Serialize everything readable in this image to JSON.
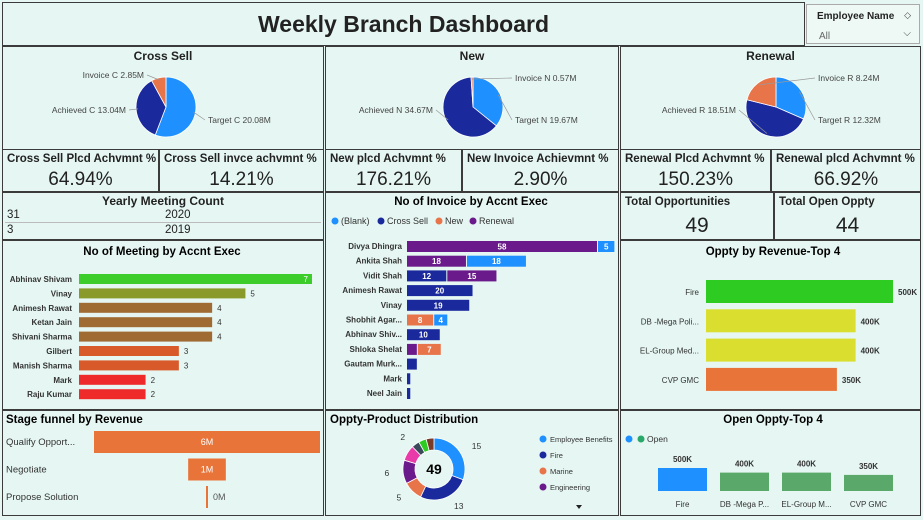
{
  "header": {
    "title": "Weekly Branch Dashboard"
  },
  "slicer": {
    "label": "Employee Name",
    "value": "All"
  },
  "pies": [
    {
      "title": "Cross Sell",
      "slices": [
        {
          "label": "Target C 20.08M",
          "value": 20.08,
          "color": "#1e90ff"
        },
        {
          "label": "Achieved C 13.04M",
          "value": 13.04,
          "color": "#1a2a9c"
        },
        {
          "label": "Invoice C 2.85M",
          "value": 2.85,
          "color": "#e8744a"
        }
      ]
    },
    {
      "title": "New",
      "slices": [
        {
          "label": "Target N 19.67M",
          "value": 19.67,
          "color": "#1e90ff"
        },
        {
          "label": "Achieved N 34.67M",
          "value": 34.67,
          "color": "#1a2a9c"
        },
        {
          "label": "Invoice N 0.57M",
          "value": 0.57,
          "color": "#e8744a"
        }
      ]
    },
    {
      "title": "Renewal",
      "slices": [
        {
          "label": "Target R 12.32M",
          "value": 12.32,
          "color": "#1e90ff"
        },
        {
          "label": "Achieved R 18.51M",
          "value": 18.51,
          "color": "#1a2a9c"
        },
        {
          "label": "Invoice R 8.24M",
          "value": 8.24,
          "color": "#e8744a"
        }
      ]
    }
  ],
  "kpis": [
    {
      "label": "Cross Sell Plcd Achvmnt %",
      "value": "64.94%"
    },
    {
      "label": "Cross Sell invce achvmnt %",
      "value": "14.21%"
    },
    {
      "label": "New plcd Achvmnt %",
      "value": "176.21%"
    },
    {
      "label": "New Invoice Achievmnt %",
      "value": "2.90%"
    },
    {
      "label": "Renewal Plcd Achvmnt %",
      "value": "150.23%"
    },
    {
      "label": "Renewal plcd Achvmnt %",
      "value": "66.92%"
    }
  ],
  "yearly_meeting": {
    "title": "Yearly Meeting Count",
    "rows": [
      {
        "count": "31",
        "year": "2020"
      },
      {
        "count": "3",
        "year": "2019"
      }
    ]
  },
  "opportunities": [
    {
      "label": "Total Opportunities",
      "value": "49"
    },
    {
      "label": "Total Open Oppty",
      "value": "44"
    }
  ],
  "chart_data": [
    {
      "type": "bar",
      "title": "No of Meeting by Accnt Exec",
      "categories": [
        "Abhinav Shivam",
        "Vinay",
        "Animesh Rawat",
        "Ketan Jain",
        "Shivani Sharma",
        "Gilbert",
        "Manish Sharma",
        "Mark",
        "Raju Kumar"
      ],
      "values": [
        7,
        5,
        4,
        4,
        4,
        3,
        3,
        2,
        2
      ],
      "colors": [
        "#3ccd2b",
        "#8a9a2a",
        "#a06a33",
        "#a06a33",
        "#a06a33",
        "#d85a2a",
        "#d85a2a",
        "#ee2a2a",
        "#ee2a2a"
      ]
    },
    {
      "type": "bar",
      "title": "No of Invoice by Accnt Exec",
      "legend": [
        {
          "name": "(Blank)",
          "color": "#1e90ff"
        },
        {
          "name": "Cross Sell",
          "color": "#1a2a9c"
        },
        {
          "name": "New",
          "color": "#e8744a"
        },
        {
          "name": "Renewal",
          "color": "#6a1a8a"
        }
      ],
      "categories": [
        "Divya Dhingra",
        "Ankita Shah",
        "Vidit Shah",
        "Animesh Rawat",
        "Vinay",
        "Shobhit Agar...",
        "Abhinav Shiv...",
        "Shloka Shelat",
        "Gautam Murk...",
        "Mark",
        "Neel Jain"
      ],
      "series": [
        {
          "name": "Renewal",
          "values": [
            58,
            18,
            15,
            null,
            null,
            null,
            null,
            3,
            null,
            null,
            null
          ]
        },
        {
          "name": "(Blank)",
          "values": [
            5,
            18,
            null,
            null,
            null,
            4,
            null,
            null,
            null,
            null,
            null
          ]
        },
        {
          "name": "Cross Sell",
          "values": [
            null,
            null,
            12,
            20,
            19,
            null,
            10,
            null,
            3,
            1,
            1
          ]
        },
        {
          "name": "New",
          "values": [
            null,
            null,
            null,
            null,
            null,
            8,
            null,
            7,
            null,
            null,
            null
          ]
        }
      ]
    },
    {
      "type": "bar",
      "title": "Oppty by Revenue-Top 4",
      "categories": [
        "Fire",
        "DB -Mega Poli...",
        "EL-Group Med...",
        "CVP GMC"
      ],
      "values": [
        500000,
        400000,
        400000,
        350000
      ],
      "value_labels": [
        "500K",
        "400K",
        "400K",
        "350K"
      ],
      "colors": [
        "#2ecc23",
        "#d9de2f",
        "#d9de2f",
        "#e8743a"
      ]
    },
    {
      "type": "bar",
      "title": "Stage funnel by Revenue",
      "categories": [
        "Qualify Opport...",
        "Negotiate",
        "Propose Solution"
      ],
      "values": [
        6000000,
        1000000,
        0
      ],
      "value_labels": [
        "6M",
        "1M",
        "0M"
      ],
      "color": "#e8743a"
    },
    {
      "type": "pie",
      "title": "Oppty-Product Distribution",
      "center_label": "49",
      "legend": [
        {
          "name": "Employee Benefits",
          "color": "#1e90ff"
        },
        {
          "name": "Fire",
          "color": "#1a2a9c"
        },
        {
          "name": "Marine",
          "color": "#e8744a"
        },
        {
          "name": "Engineering",
          "color": "#6a1a8a"
        }
      ],
      "slices": [
        {
          "label": "15",
          "value": 15,
          "color": "#1e90ff"
        },
        {
          "label": "13",
          "value": 13,
          "color": "#1a2a9c"
        },
        {
          "label": "5",
          "value": 5,
          "color": "#e8744a"
        },
        {
          "label": "6",
          "value": 6,
          "color": "#6a1a8a"
        },
        {
          "label": "",
          "value": 4,
          "color": "#e83aa8"
        },
        {
          "label": "2",
          "value": 2,
          "color": "#3a4a5a"
        },
        {
          "label": "",
          "value": 2,
          "color": "#2ecc23"
        },
        {
          "label": "",
          "value": 2,
          "color": "#7a3a2a"
        }
      ]
    },
    {
      "type": "bar",
      "title": "Open Oppty-Top 4",
      "legend": [
        {
          "name": "Open",
          "color": "#1e90ff"
        },
        {
          "name": "",
          "color": "#2aa86a"
        }
      ],
      "categories": [
        "Fire",
        "DB -Mega P...",
        "EL-Group M...",
        "CVP GMC"
      ],
      "values": [
        500000,
        400000,
        400000,
        350000
      ],
      "value_labels": [
        "500K",
        "400K",
        "400K",
        "350K"
      ],
      "colors": [
        "#1e90ff",
        "#5aa86a",
        "#5aa86a",
        "#5aa86a"
      ]
    }
  ]
}
